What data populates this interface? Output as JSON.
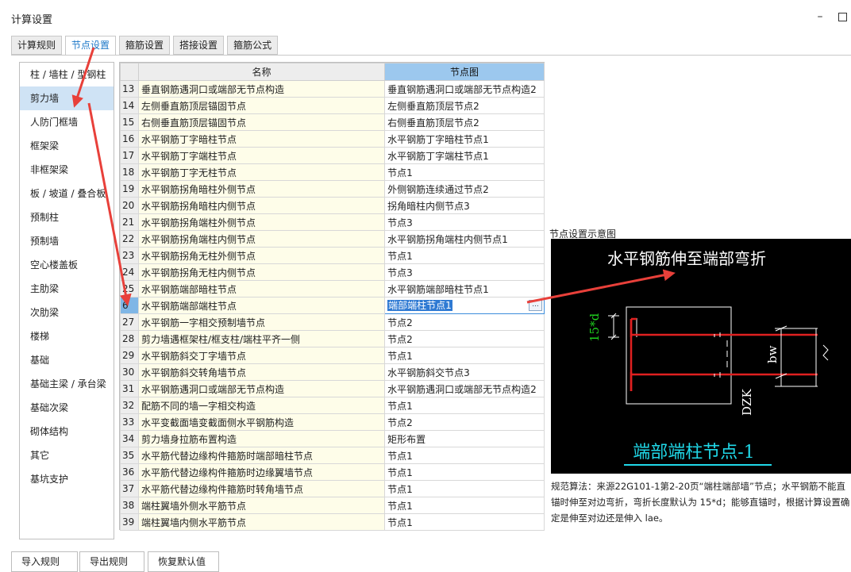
{
  "window": {
    "title": "计算设置",
    "minimize": "–"
  },
  "tabs": [
    "计算规则",
    "节点设置",
    "箍筋设置",
    "搭接设置",
    "箍筋公式"
  ],
  "sidebar": [
    "柱 / 墙柱 / 型钢柱",
    "剪力墙",
    "人防门框墙",
    "框架梁",
    "非框架梁",
    "板 / 坡道 / 叠合板",
    "预制柱",
    "预制墙",
    "空心楼盖板",
    "主肋梁",
    "次肋梁",
    "楼梯",
    "基础",
    "基础主梁 / 承台梁",
    "基础次梁",
    "砌体结构",
    "其它",
    "基坑支护"
  ],
  "table": {
    "headers": {
      "name": "名称",
      "node": "节点图"
    },
    "rows": [
      {
        "i": "13",
        "name": "垂直钢筋遇洞口或端部无节点构造",
        "node": "垂直钢筋遇洞口或端部无节点构造2"
      },
      {
        "i": "14",
        "name": "左侧垂直筋顶层锚固节点",
        "node": "左侧垂直筋顶层节点2"
      },
      {
        "i": "15",
        "name": "右侧垂直筋顶层锚固节点",
        "node": "右侧垂直筋顶层节点2"
      },
      {
        "i": "16",
        "name": "水平钢筋丁字暗柱节点",
        "node": "水平钢筋丁字暗柱节点1"
      },
      {
        "i": "17",
        "name": "水平钢筋丁字端柱节点",
        "node": "水平钢筋丁字端柱节点1"
      },
      {
        "i": "18",
        "name": "水平钢筋丁字无柱节点",
        "node": "节点1"
      },
      {
        "i": "19",
        "name": "水平钢筋拐角暗柱外侧节点",
        "node": "外侧钢筋连续通过节点2"
      },
      {
        "i": "20",
        "name": "水平钢筋拐角暗柱内侧节点",
        "node": "拐角暗柱内侧节点3"
      },
      {
        "i": "21",
        "name": "水平钢筋拐角端柱外侧节点",
        "node": "节点3"
      },
      {
        "i": "22",
        "name": "水平钢筋拐角端柱内侧节点",
        "node": "水平钢筋拐角端柱内侧节点1"
      },
      {
        "i": "23",
        "name": "水平钢筋拐角无柱外侧节点",
        "node": "节点1"
      },
      {
        "i": "24",
        "name": "水平钢筋拐角无柱内侧节点",
        "node": "节点3"
      },
      {
        "i": "25",
        "name": "水平钢筋端部暗柱节点",
        "node": "水平钢筋端部暗柱节点1"
      },
      {
        "i": "6",
        "name": "水平钢筋端部端柱节点",
        "node": "端部端柱节点1"
      },
      {
        "i": "27",
        "name": "水平钢筋一字相交预制墙节点",
        "node": "节点2"
      },
      {
        "i": "28",
        "name": "剪力墙遇框架柱/框支柱/端柱平齐一侧",
        "node": "节点2"
      },
      {
        "i": "29",
        "name": "水平钢筋斜交丁字墙节点",
        "node": "节点1"
      },
      {
        "i": "30",
        "name": "水平钢筋斜交转角墙节点",
        "node": "水平钢筋斜交节点3"
      },
      {
        "i": "31",
        "name": "水平钢筋遇洞口或端部无节点构造",
        "node": "水平钢筋遇洞口或端部无节点构造2"
      },
      {
        "i": "32",
        "name": "配筋不同的墙一字相交构造",
        "node": "节点1"
      },
      {
        "i": "33",
        "name": "水平变截面墙变截面侧水平钢筋构造",
        "node": "节点2"
      },
      {
        "i": "34",
        "name": "剪力墙身拉筋布置构造",
        "node": "矩形布置"
      },
      {
        "i": "35",
        "name": "水平筋代替边缘构件箍筋时端部暗柱节点",
        "node": "节点1"
      },
      {
        "i": "36",
        "name": "水平筋代替边缘构件箍筋时边缘翼墙节点",
        "node": "节点1"
      },
      {
        "i": "37",
        "name": "水平筋代替边缘构件箍筋时转角墙节点",
        "node": "节点1"
      },
      {
        "i": "38",
        "name": "端柱翼墙外侧水平筋节点",
        "node": "节点1"
      },
      {
        "i": "39",
        "name": "端柱翼墙内侧水平筋节点",
        "node": "节点1"
      }
    ]
  },
  "editor": {
    "ellipsis": "..."
  },
  "diagram": {
    "panel_title": "节点设置示意图",
    "top_text": "水平钢筋伸至端部弯折",
    "dim_label": "15*d",
    "bw_label": "bw",
    "dzk_label": "DZK",
    "bottom_text": "端部端柱节点-1",
    "description": "规范算法：来源22G101-1第2-20页“端柱端部墙”节点；水平钢筋不能直锚时伸至对边弯折，弯折长度默认为 15*d；能够直锚时，根据计算设置确定是伸至对边还是伸入 lae。"
  },
  "buttons": {
    "import": "导入规则",
    "export": "导出规则",
    "reset": "恢复默认值"
  },
  "colors": {
    "accent": "#1e78c8",
    "annotation_arrow": "#e8403a",
    "rebar": "#e02020",
    "label_green": "#1fd11f",
    "label_cyan": "#20d8e8"
  }
}
